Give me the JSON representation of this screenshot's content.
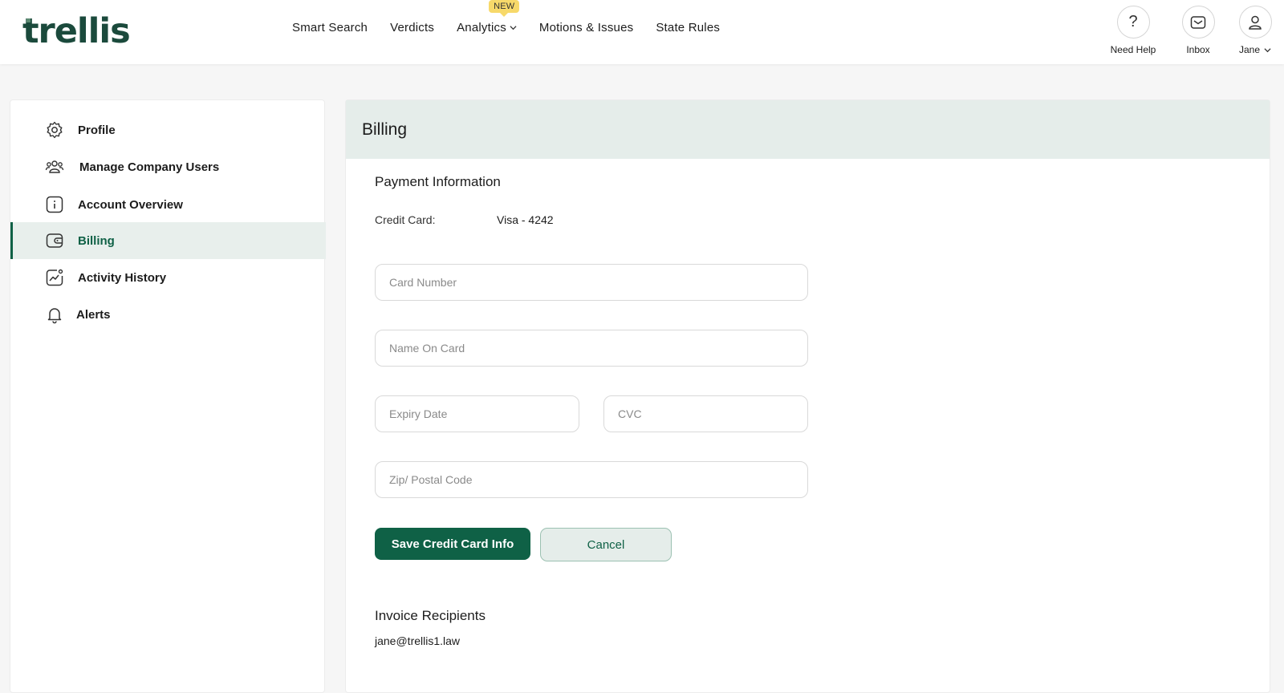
{
  "header": {
    "logo": "trellis",
    "nav": [
      {
        "label": "Smart Search"
      },
      {
        "label": "Verdicts"
      },
      {
        "label": "Analytics",
        "badge": "NEW",
        "has_dropdown": true
      },
      {
        "label": "Motions & Issues"
      },
      {
        "label": "State Rules"
      }
    ],
    "need_help": {
      "label": "Need Help",
      "glyph": "?"
    },
    "inbox": {
      "label": "Inbox"
    },
    "user": {
      "label": "Jane"
    }
  },
  "sidebar": {
    "items": [
      {
        "label": "Profile",
        "icon": "gear-icon"
      },
      {
        "label": "Manage Company Users",
        "icon": "users-icon"
      },
      {
        "label": "Account Overview",
        "icon": "info-icon"
      },
      {
        "label": "Billing",
        "icon": "wallet-icon",
        "active": true
      },
      {
        "label": "Activity History",
        "icon": "activity-chart-icon"
      },
      {
        "label": "Alerts",
        "icon": "bell-icon"
      }
    ]
  },
  "billing": {
    "title": "Billing",
    "payment_title": "Payment Information",
    "credit_card_label": "Credit Card:",
    "credit_card_value": "Visa - 4242",
    "fields": {
      "card_number": {
        "placeholder": "Card Number",
        "value": ""
      },
      "name_on_card": {
        "placeholder": "Name On Card",
        "value": ""
      },
      "expiry_date": {
        "placeholder": "Expiry Date",
        "value": ""
      },
      "cvc": {
        "placeholder": "CVC",
        "value": ""
      },
      "zip": {
        "placeholder": "Zip/ Postal Code",
        "value": ""
      }
    },
    "save_label": "Save Credit Card Info",
    "cancel_label": "Cancel",
    "invoice_title": "Invoice Recipients",
    "invoice_email": "jane@trellis1.law"
  },
  "colors": {
    "brand_green": "#0f6146",
    "logo_green": "#1b4a3c",
    "header_tint": "#e5edea",
    "badge_yellow": "#f7d96a"
  }
}
